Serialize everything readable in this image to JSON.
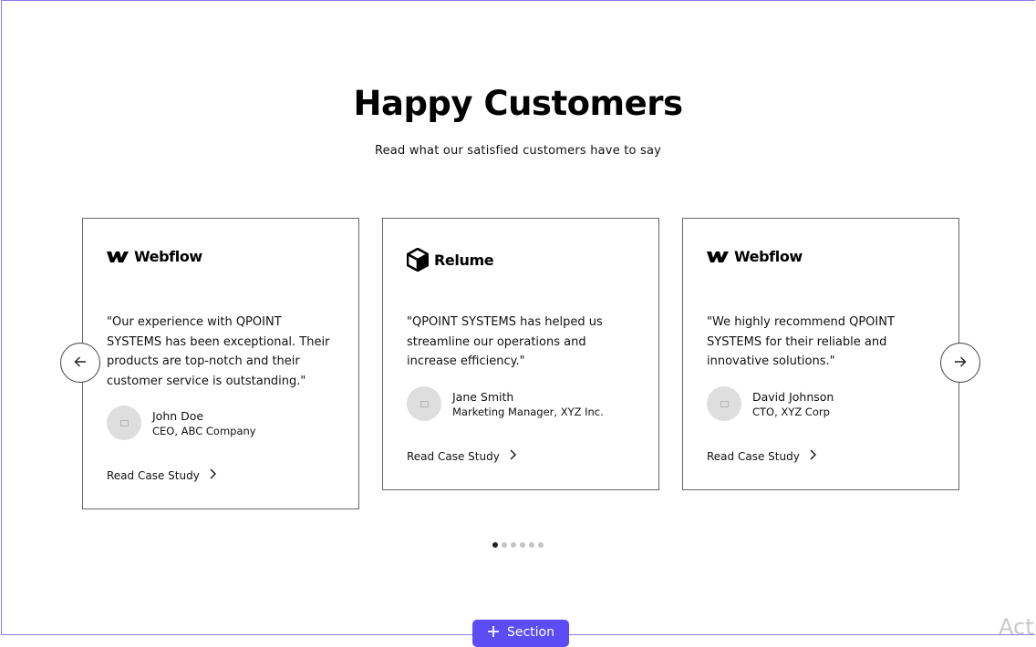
{
  "section": {
    "title": "Happy Customers",
    "subtitle": "Read what our satisfied customers have to say"
  },
  "cards": [
    {
      "logo_icon": "webflow-logo-icon",
      "logo_text": "Webflow",
      "quote": "\"Our experience with QPOINT SYSTEMS has been exceptional. Their products are top-notch and their customer service is outstanding.\"",
      "author_name": "John Doe",
      "author_role": "CEO, ABC Company",
      "link_label": "Read Case Study"
    },
    {
      "logo_icon": "relume-logo-icon",
      "logo_text": "Relume",
      "quote": "\"QPOINT SYSTEMS has helped us streamline our operations and increase efficiency.\"",
      "author_name": "Jane Smith",
      "author_role": "Marketing Manager, XYZ Inc.",
      "link_label": "Read Case Study"
    },
    {
      "logo_icon": "webflow-logo-icon",
      "logo_text": "Webflow",
      "quote": "\"We highly recommend QPOINT SYSTEMS for their reliable and innovative solutions.\"",
      "author_name": "David Johnson",
      "author_role": "CTO, XYZ Corp",
      "link_label": "Read Case Study"
    }
  ],
  "carousel": {
    "prev_icon": "arrow-left-icon",
    "next_icon": "arrow-right-icon",
    "dot_count": 6,
    "active_dot": 1
  },
  "editor": {
    "add_section_label": "Section",
    "add_section_icon": "plus-icon",
    "watermark_text": "Acti"
  },
  "colors": {
    "accent": "#5b4cf5",
    "frame_border": "#8b7cf0",
    "avatar_bg": "#dedede",
    "dot_active": "#222222",
    "dot_inactive": "#c4c4c4"
  }
}
